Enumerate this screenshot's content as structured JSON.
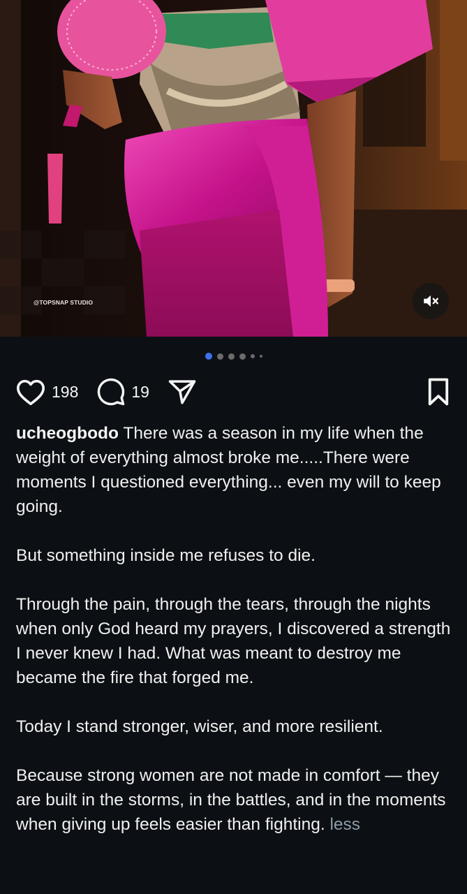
{
  "media": {
    "watermark": "@TOPSNAP STUDIO",
    "mute_icon": "speaker-muted-icon",
    "carousel": {
      "total": 6,
      "active_index": 0
    }
  },
  "actions": {
    "like_icon": "heart-outline-icon",
    "like_count": "198",
    "comment_icon": "comment-bubble-icon",
    "comment_count": "19",
    "share_icon": "paper-plane-icon",
    "save_icon": "bookmark-outline-icon"
  },
  "caption": {
    "username": "ucheogbodo",
    "paragraphs": [
      "There was a season in my life when the weight of everything almost broke me.....There were moments I questioned everything... even my will to keep going.",
      "But something inside me refuses to die.",
      "Through the pain, through the tears, through the nights when only God heard my prayers, I discovered a strength I never knew I had. What was meant to destroy me became the fire that forged me.",
      "Today I stand stronger, wiser, and more resilient.",
      "Because strong women are not made in comfort — they are built in the storms, in the battles, and in the moments when giving up feels easier than fighting."
    ],
    "less_label": "less"
  },
  "colors": {
    "background": "#0c1014",
    "active_dot": "#3e6ff0",
    "inactive_dot": "#6b6b6b",
    "less_link": "#8e9aa6",
    "dress_pink": "#d9259b"
  }
}
